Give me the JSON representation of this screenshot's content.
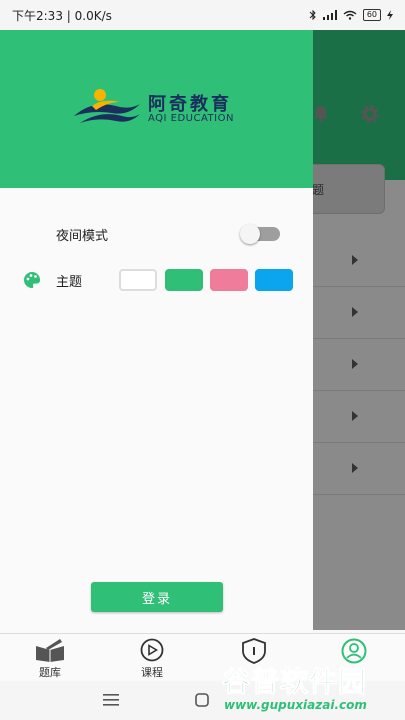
{
  "status_bar": {
    "time_speed": "下午2:33 | 0.0K/s",
    "battery": "60"
  },
  "background_app": {
    "card_label": "题"
  },
  "drawer": {
    "logo_cn": "阿奇教育",
    "logo_en": "AQI EDUCATION",
    "night_mode_label": "夜间模式",
    "night_mode_on": false,
    "theme_label": "主题",
    "theme_colors": [
      "#ffffff",
      "#2fbf77",
      "#f07c9c",
      "#0aa4ef"
    ],
    "login_label": "登录"
  },
  "bottom_nav": {
    "tabs": [
      {
        "label": "题库"
      },
      {
        "label": "课程"
      },
      {
        "label": ""
      },
      {
        "label": ""
      }
    ]
  },
  "watermark": {
    "big": "谷普软件园",
    "small": "www.gupuxiazai.com"
  },
  "colors": {
    "brand_green": "#2fbf77",
    "pink": "#f07c9c",
    "blue": "#0aa4ef"
  }
}
